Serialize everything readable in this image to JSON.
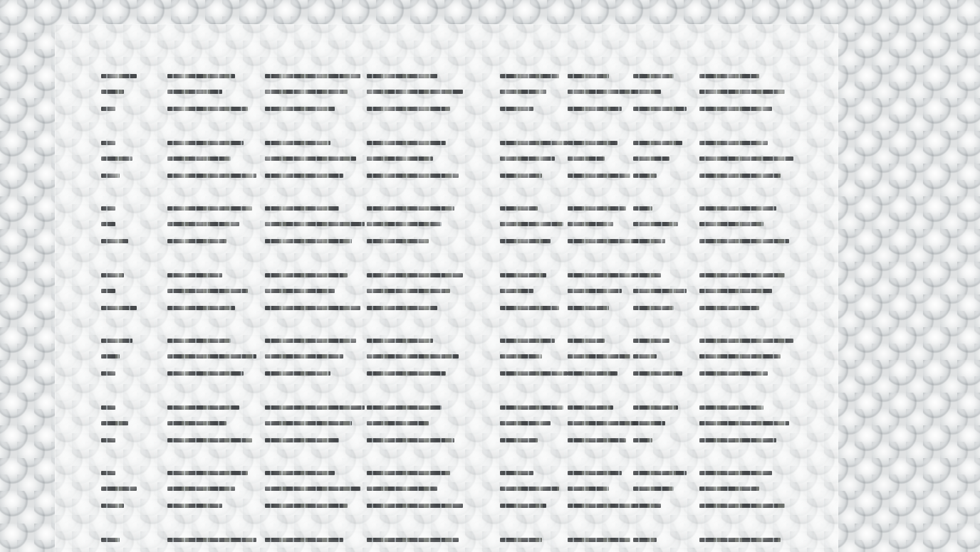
{
  "background": {
    "texture": "bubble-wrap",
    "base_color": "#d9dcdd",
    "panel_color": "#f4f5f5"
  },
  "text_rows": {
    "ink_color": "#2a2d30",
    "rows": 8
  }
}
